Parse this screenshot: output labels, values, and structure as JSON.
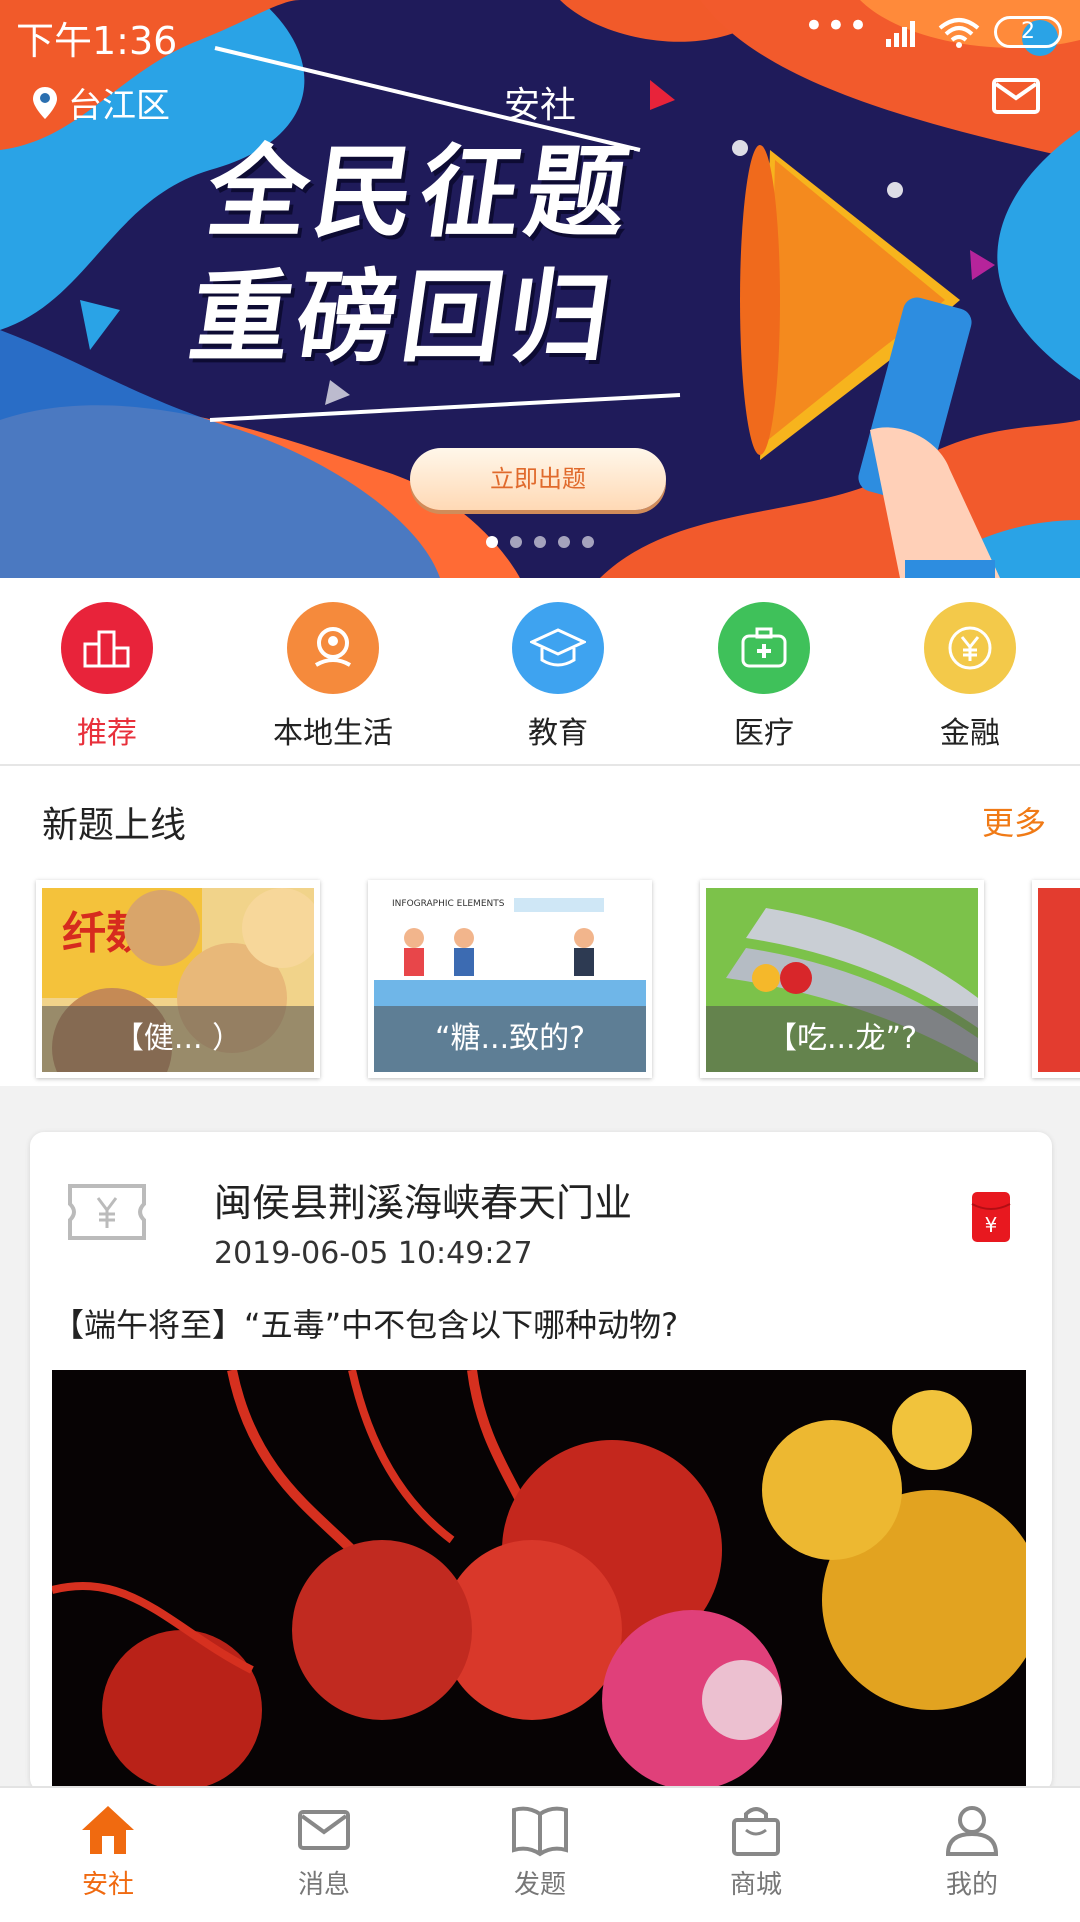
{
  "status_bar": {
    "time": "下午1:36",
    "battery": "2"
  },
  "header": {
    "location": "台江区",
    "title": "安社"
  },
  "banner": {
    "headline_line1": "全民征题",
    "headline_line2": "重磅回归",
    "cta_label": "立即出题",
    "slide_count": 5,
    "active_slide": 1
  },
  "categories": [
    {
      "label": "推荐",
      "icon": "podium-icon",
      "color": "#e8233a"
    },
    {
      "label": "本地生活",
      "icon": "location-person-icon",
      "color": "#f58a3c"
    },
    {
      "label": "教育",
      "icon": "graduation-cap-icon",
      "color": "#3ea3f0"
    },
    {
      "label": "医疗",
      "icon": "medical-kit-icon",
      "color": "#3fc15a"
    },
    {
      "label": "金融",
      "icon": "yuan-coin-icon",
      "color": "#f3c94a"
    }
  ],
  "new_questions": {
    "heading": "新题上线",
    "more_label": "更多",
    "cards": [
      {
        "caption": "【健...  ）",
        "image_label": "纤麸"
      },
      {
        "caption": "“糖...致的?",
        "image_label": "INFOGRAPHIC ELEMENTS"
      },
      {
        "caption": "【吃...龙”?",
        "image_label": ""
      }
    ]
  },
  "post": {
    "publisher": "闽侯县荆溪海峡春天门业",
    "time": "2019-06-05 10:49:27",
    "question": "【端午将至】“五毒”中不包含以下哪种动物?",
    "voucher_icon": "voucher-yuan-icon",
    "red_packet_icon": "red-packet-icon"
  },
  "tabs": [
    {
      "label": "安社",
      "icon": "home-icon",
      "active": true
    },
    {
      "label": "消息",
      "icon": "message-icon",
      "active": false
    },
    {
      "label": "发题",
      "icon": "book-icon",
      "active": false
    },
    {
      "label": "商城",
      "icon": "shopping-bag-icon",
      "active": false
    },
    {
      "label": "我的",
      "icon": "person-icon",
      "active": false
    }
  ],
  "colors": {
    "accent_orange": "#f06a10",
    "more_orange": "#f07a16",
    "active_red": "#e8303b"
  }
}
